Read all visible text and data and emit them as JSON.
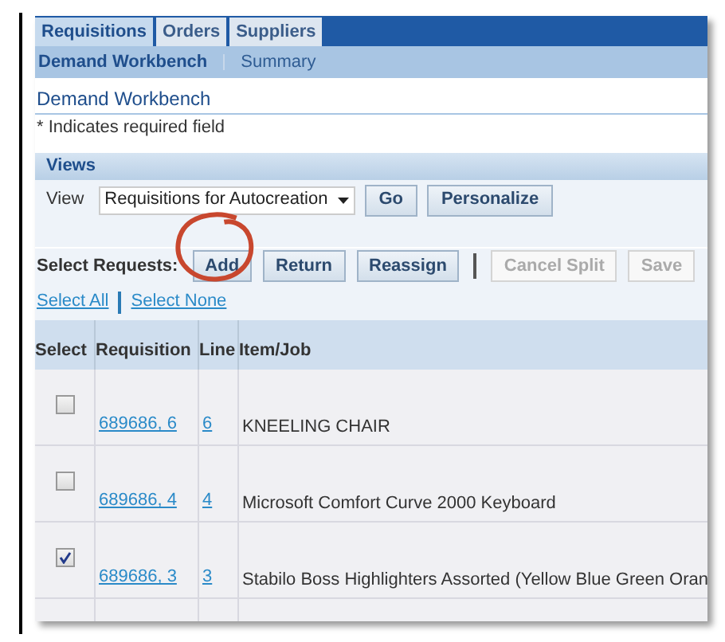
{
  "tabs": [
    {
      "label": "Requisitions",
      "selected": true
    },
    {
      "label": "Orders",
      "selected": false
    },
    {
      "label": "Suppliers",
      "selected": false
    }
  ],
  "subtabs": [
    {
      "label": "Demand Workbench",
      "selected": true
    },
    {
      "label": "Summary",
      "selected": false
    }
  ],
  "page_title": "Demand Workbench",
  "required_note": "* Indicates required field",
  "views": {
    "title": "Views",
    "label": "View",
    "value": "Requisitions for Autocreation",
    "buttons": [
      "Go",
      "Personalize"
    ]
  },
  "actions": {
    "label": "Select Requests:",
    "buttons": [
      {
        "label": "Add",
        "disabled": false
      },
      {
        "label": "Return",
        "disabled": false
      },
      {
        "label": "Reassign",
        "disabled": false
      },
      {
        "label": "Cancel Split",
        "disabled": true
      },
      {
        "label": "Save",
        "disabled": true
      }
    ]
  },
  "links": [
    "Select All",
    "Select None"
  ],
  "table": {
    "columns": [
      "Select",
      "Requisition",
      "Line",
      "Item/Job"
    ],
    "rows": [
      {
        "checked": false,
        "requisition": "689686, 6",
        "line": "6",
        "item": "KNEELING CHAIR"
      },
      {
        "checked": false,
        "requisition": "689686, 4",
        "line": "4",
        "item": "Microsoft Comfort Curve 2000 Keyboard"
      },
      {
        "checked": true,
        "requisition": "689686, 3",
        "line": "3",
        "item": "Stabilo Boss Highlighters Assorted (Yellow Blue Green Oran"
      }
    ]
  }
}
